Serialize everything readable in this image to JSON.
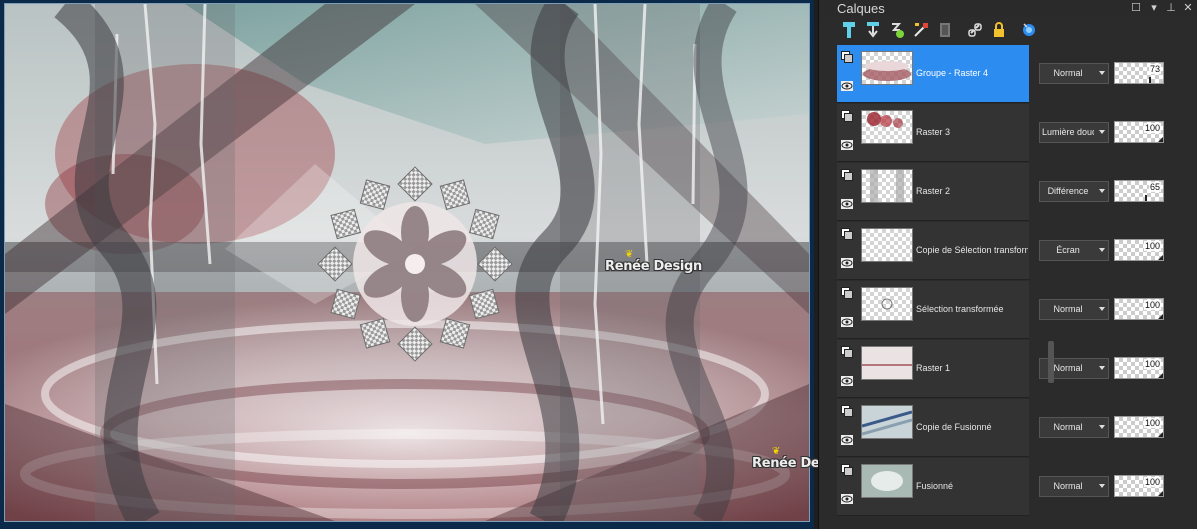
{
  "canvas": {
    "watermark_1": "Renée Design",
    "watermark_2": "Renée Design"
  },
  "panel": {
    "title": "Calques",
    "window_controls": [
      "☐",
      "▾",
      "⊥",
      "✕"
    ],
    "toolbar_icons": [
      "new-raster-layer-icon",
      "new-vector-layer-icon",
      "new-mask-icon",
      "edit-icon",
      "delete-layer-icon",
      "link-icon",
      "lock-icon",
      "properties-icon"
    ],
    "accent_color": "#2c8cf0",
    "layers": [
      {
        "name": "Groupe - Raster 4",
        "blend": "Normal",
        "opacity": "73",
        "selected": true
      },
      {
        "name": "Raster 3",
        "blend": "Lumière douce",
        "opacity": "100",
        "selected": false
      },
      {
        "name": "Raster 2",
        "blend": "Différence",
        "opacity": "65",
        "selected": false
      },
      {
        "name": "Copie de Sélection transform",
        "blend": "Écran",
        "opacity": "100",
        "selected": false
      },
      {
        "name": "Sélection transformée",
        "blend": "Normal",
        "opacity": "100",
        "selected": false
      },
      {
        "name": "Raster 1",
        "blend": "Normal",
        "opacity": "100",
        "selected": false
      },
      {
        "name": "Copie de Fusionné",
        "blend": "Normal",
        "opacity": "100",
        "selected": false
      },
      {
        "name": "Fusionné",
        "blend": "Normal",
        "opacity": "100",
        "selected": false
      }
    ]
  }
}
